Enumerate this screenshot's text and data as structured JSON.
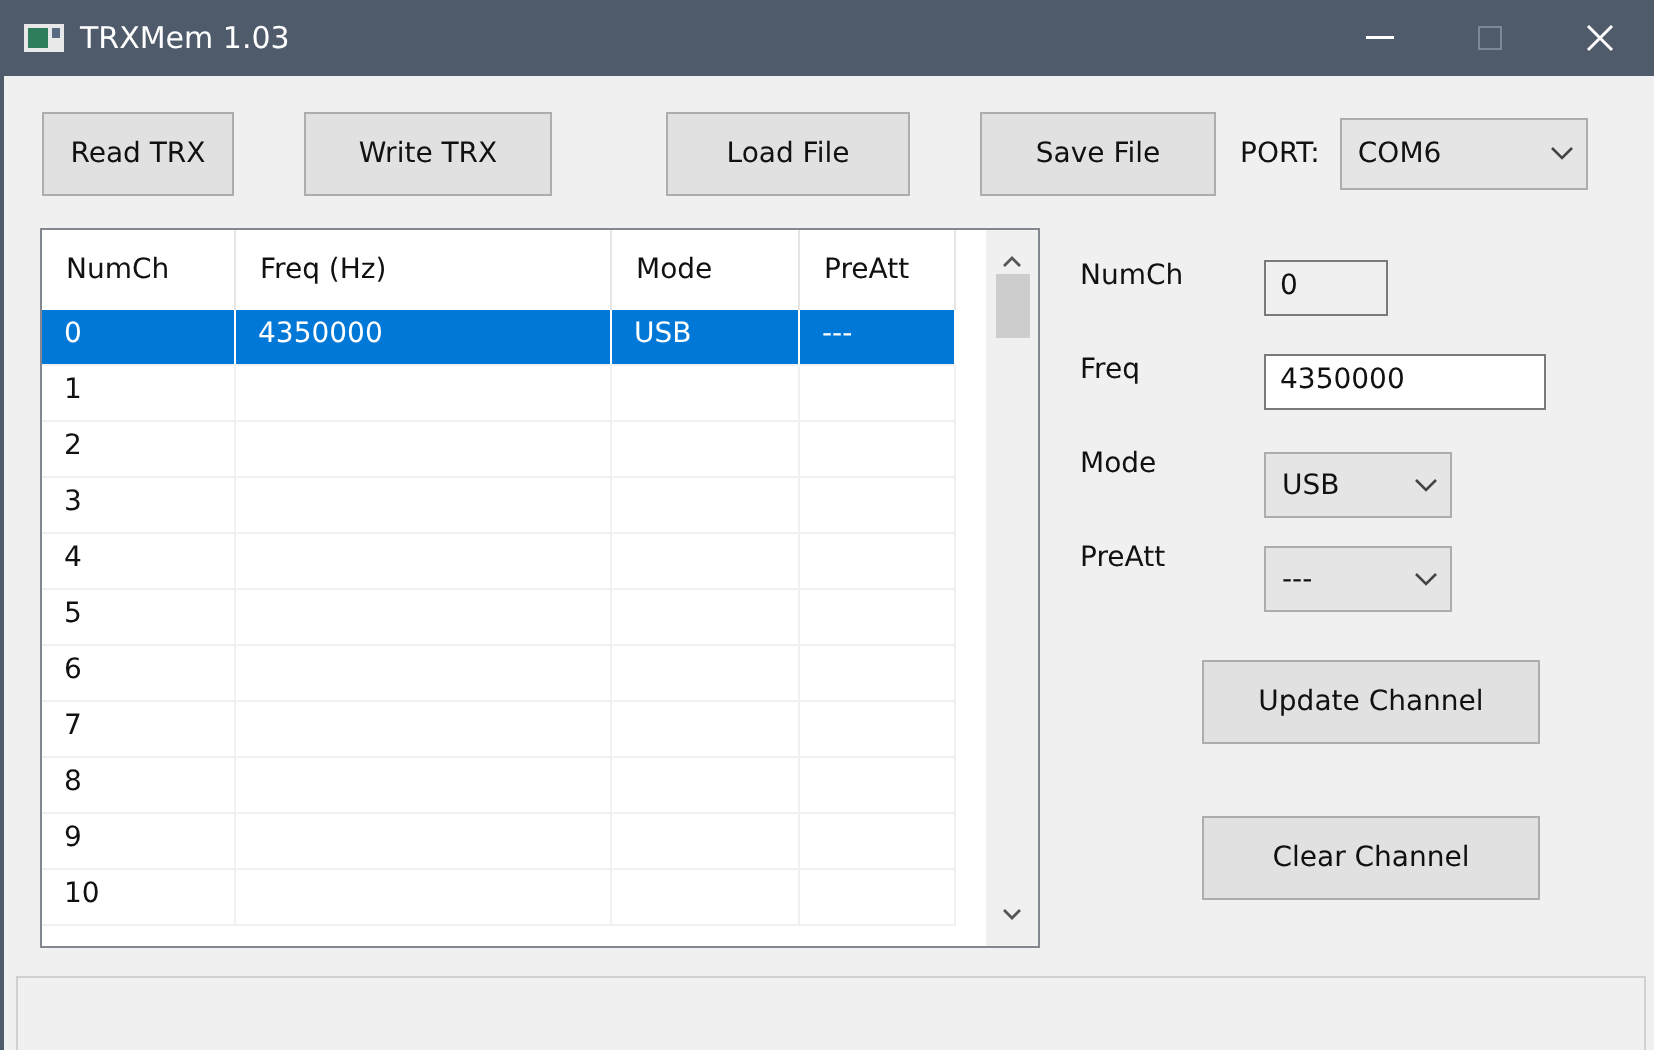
{
  "window": {
    "title": "TRXMem 1.03"
  },
  "toolbar": {
    "buttons": [
      "Read TRX",
      "Write TRX",
      "Load File",
      "Save File"
    ],
    "port_label": "PORT:",
    "port_value": "COM6"
  },
  "table": {
    "columns": [
      "NumCh",
      "Freq (Hz)",
      "Mode",
      "PreAtt"
    ],
    "rows": [
      {
        "cells": [
          "0",
          "4350000",
          "USB",
          "---"
        ],
        "selected": true
      },
      {
        "cells": [
          "1",
          "",
          "",
          ""
        ],
        "selected": false
      },
      {
        "cells": [
          "2",
          "",
          "",
          ""
        ],
        "selected": false
      },
      {
        "cells": [
          "3",
          "",
          "",
          ""
        ],
        "selected": false
      },
      {
        "cells": [
          "4",
          "",
          "",
          ""
        ],
        "selected": false
      },
      {
        "cells": [
          "5",
          "",
          "",
          ""
        ],
        "selected": false
      },
      {
        "cells": [
          "6",
          "",
          "",
          ""
        ],
        "selected": false
      },
      {
        "cells": [
          "7",
          "",
          "",
          ""
        ],
        "selected": false
      },
      {
        "cells": [
          "8",
          "",
          "",
          ""
        ],
        "selected": false
      },
      {
        "cells": [
          "9",
          "",
          "",
          ""
        ],
        "selected": false
      },
      {
        "cells": [
          "10",
          "",
          "",
          ""
        ],
        "selected": false
      }
    ]
  },
  "editor": {
    "fields": [
      {
        "kind": "readonly",
        "label": "NumCh",
        "value": "0"
      },
      {
        "kind": "text",
        "label": "Freq",
        "value": "4350000"
      },
      {
        "kind": "select",
        "label": "Mode",
        "value": "USB"
      },
      {
        "kind": "select",
        "label": "PreAtt",
        "value": "---"
      }
    ],
    "buttons": [
      "Update Channel",
      "Clear Channel"
    ]
  }
}
